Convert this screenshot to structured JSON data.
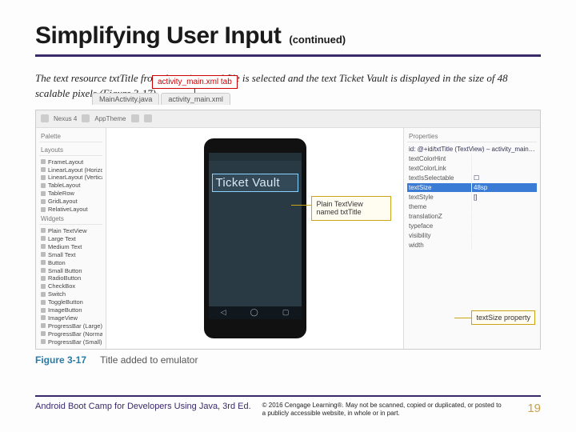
{
  "header": {
    "title": "Simplifying User Input",
    "subtitle": "(continued)"
  },
  "intro": "The text resource txtTitle from the strings.xml file is selected and the text Ticket Vault is displayed in the size of 48 scalable pixels (Figure 3-17).",
  "shot": {
    "tabs": {
      "left": "MainActivity.java",
      "right": "activity_main.xml"
    },
    "callouts": {
      "tab": "activity_main.xml tab",
      "textview": "Plain TextView named txtTitle",
      "prop": "textSize property"
    },
    "toolbar": {
      "device": "Nexus 4",
      "api": "AppTheme"
    },
    "palette": {
      "header": "Palette",
      "groups": {
        "layouts": "Layouts",
        "widgets": "Widgets"
      },
      "items_layouts": [
        "FrameLayout",
        "LinearLayout (Horizontal)",
        "LinearLayout (Vertical)",
        "TableLayout",
        "TableRow",
        "GridLayout",
        "RelativeLayout"
      ],
      "items_widgets": [
        "Plain TextView",
        "Large Text",
        "Medium Text",
        "Small Text",
        "Button",
        "Small Button",
        "RadioButton",
        "CheckBox",
        "Switch",
        "ToggleButton",
        "ImageButton",
        "ImageView",
        "ProgressBar (Large)",
        "ProgressBar (Normal)",
        "ProgressBar (Small)"
      ]
    },
    "phone": {
      "title_text": "Ticket Vault",
      "nav": {
        "back": "◁",
        "home": "◯",
        "recents": "▢"
      }
    },
    "properties": {
      "header": "Properties",
      "component": "id: @+id/txtTitle (TextView) – activity_main.xml",
      "rows": [
        {
          "k": "textColorHint",
          "v": ""
        },
        {
          "k": "textColorLink",
          "v": ""
        },
        {
          "k": "textIsSelectable",
          "v": "☐"
        },
        {
          "k": "textSize",
          "v": "48sp",
          "sel": true
        },
        {
          "k": "textStyle",
          "v": "[]"
        },
        {
          "k": "theme",
          "v": ""
        },
        {
          "k": "translationZ",
          "v": ""
        },
        {
          "k": "typeface",
          "v": ""
        },
        {
          "k": "visibility",
          "v": ""
        },
        {
          "k": "width",
          "v": ""
        }
      ]
    }
  },
  "caption": {
    "num": "Figure 3-17",
    "text": "Title added to emulator"
  },
  "footer": {
    "book": "Android Boot Camp for Developers Using Java, 3rd Ed.",
    "copyright": "© 2016 Cengage Learning®. May not be scanned, copied or duplicated, or posted to a publicly accessible website, in whole or in part.",
    "page": "19"
  }
}
